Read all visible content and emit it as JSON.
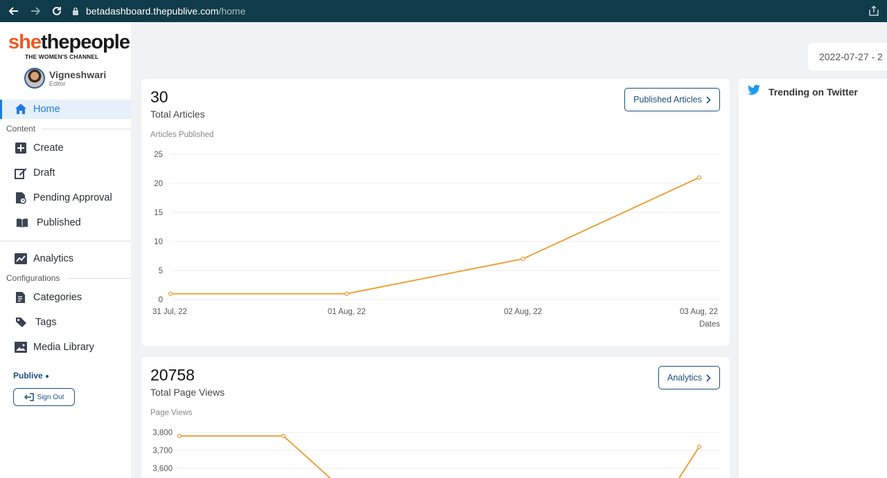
{
  "browser": {
    "url_host": "betadashboard.thepublive.com",
    "url_path": "/home"
  },
  "brand": {
    "logo_prefix": "she",
    "logo_rest": "thepeople",
    "logo_sub": "THE WOMEN'S CHANNEL",
    "accent": "#ea5b25"
  },
  "user": {
    "name": "Vigneshwari",
    "role": "Editor"
  },
  "sidebar": {
    "home": "Home",
    "content_label": "Content",
    "create": "Create",
    "draft": "Draft",
    "pending": "Pending Approval",
    "published": "Published",
    "analytics": "Analytics",
    "config_label": "Configurations",
    "categories": "Categories",
    "tags": "Tags",
    "media": "Media Library",
    "publive": "Publive",
    "signout": "Sign Out"
  },
  "date_range": "2022-07-27 - 2",
  "articles_card": {
    "count": "30",
    "subtitle": "Total Articles",
    "chart_title": "Articles Published",
    "button": "Published Articles"
  },
  "views_card": {
    "count": "20758",
    "subtitle": "Total Page Views",
    "chart_title": "Page Views",
    "button": "Analytics"
  },
  "twitter": {
    "title": "Trending on Twitter"
  },
  "chart_data": [
    {
      "type": "line",
      "title": "Articles Published",
      "xlabel": "Dates",
      "ylabel": "",
      "categories": [
        "31 Jul, 22",
        "01 Aug, 22",
        "02 Aug, 22",
        "03 Aug, 22"
      ],
      "values": [
        1,
        1,
        7,
        21
      ],
      "ylim": [
        0,
        25
      ],
      "yticks": [
        0,
        5,
        10,
        15,
        20,
        25
      ],
      "color": "#e9a23b"
    },
    {
      "type": "line",
      "title": "Page Views",
      "xlabel": "",
      "ylabel": "",
      "categories": [
        "",
        "",
        "",
        "",
        "",
        "",
        ""
      ],
      "values": [
        3780,
        3780,
        null,
        null,
        null,
        null,
        3720
      ],
      "yticks": [
        "3,600",
        "3,700",
        "3,800"
      ],
      "yvalues": [
        3600,
        3700,
        3800
      ],
      "color": "#e9a23b"
    }
  ]
}
